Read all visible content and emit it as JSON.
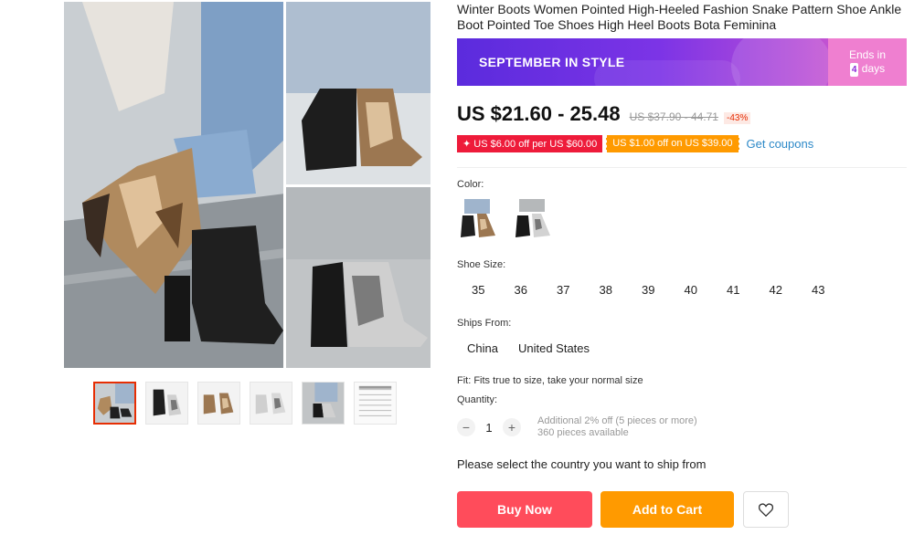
{
  "product": {
    "title": "Winter Boots Women Pointed High-Heeled Fashion Snake Pattern Shoe Ankle Boot Pointed Toe Shoes High Heel Boots Bota Feminina"
  },
  "banner": {
    "text": "SEPTEMBER IN STYLE",
    "ends_prefix": "Ends in",
    "ends_days": "4",
    "ends_suffix": "days",
    "colors": {
      "start": "#5b2bdd",
      "end": "#e963c4"
    }
  },
  "price": {
    "current": "US $21.60 - 25.48",
    "original": "US $37.90 - 44.71",
    "discount": "-43%"
  },
  "coupons": {
    "red": "✦ US $6.00 off per US $60.00",
    "orange": "US $1.00 off on US $39.00",
    "link": "Get coupons"
  },
  "options": {
    "color_label": "Color:",
    "colors": [
      {
        "name": "brown-snake",
        "icon": "boot-thumbnail"
      },
      {
        "name": "white-snake",
        "icon": "boot-thumbnail"
      }
    ],
    "size_label": "Shoe Size:",
    "sizes": [
      "35",
      "36",
      "37",
      "38",
      "39",
      "40",
      "41",
      "42",
      "43"
    ],
    "ships_label": "Ships From:",
    "ships": [
      "China",
      "United States"
    ]
  },
  "fit_text": "Fit: Fits true to size, take your normal size",
  "quantity": {
    "label": "Quantity:",
    "minus": "−",
    "plus": "+",
    "value": "1",
    "additional": "Additional 2% off (5 pieces or more)",
    "available": "360 pieces available"
  },
  "ship_message": "Please select the country you want to ship from",
  "actions": {
    "buy_now": "Buy Now",
    "add_to_cart": "Add to Cart",
    "wishlist_icon": "heart-icon"
  },
  "colors": {
    "buy": "#ff4c5b",
    "cart": "#ff9a00",
    "coupon_red": "#ee1b3a",
    "link": "#2d89c8"
  }
}
